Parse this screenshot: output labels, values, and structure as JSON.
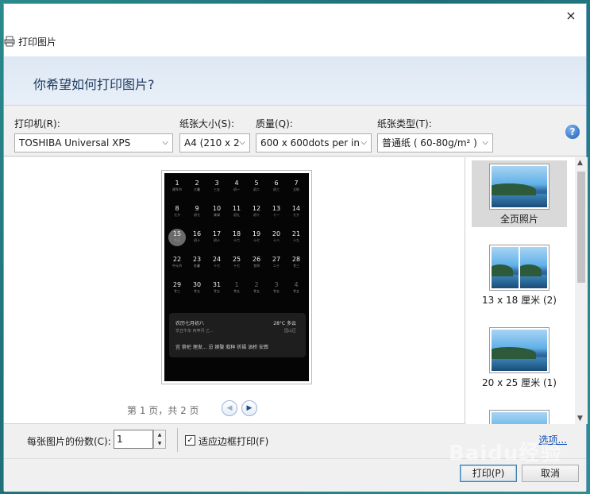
{
  "window": {
    "title": "打印图片",
    "close_glyph": "×"
  },
  "banner": {
    "heading": "你希望如何打印图片?"
  },
  "controls": {
    "printer": {
      "label": "打印机(R):",
      "value": "TOSHIBA Universal XPS"
    },
    "paper_size": {
      "label": "纸张大小(S):",
      "value": "A4 (210 x 2"
    },
    "quality": {
      "label": "质量(Q):",
      "value": "600 x 600dots per in"
    },
    "paper_type": {
      "label": "纸张类型(T):",
      "value": "普通纸 ( 60-80g/m² )"
    },
    "dropdown_glyph": "⌵",
    "help_glyph": "?"
  },
  "preview": {
    "calendar_rows": [
      [
        {
          "n": "1",
          "s": "建军节"
        },
        {
          "n": "2",
          "s": "大暑"
        },
        {
          "n": "3",
          "s": "三五"
        },
        {
          "n": "4",
          "s": "初一"
        },
        {
          "n": "5",
          "s": "初二"
        },
        {
          "n": "6",
          "s": "初三"
        },
        {
          "n": "7",
          "s": "立秋"
        }
      ],
      [
        {
          "n": "8",
          "s": "七夕"
        },
        {
          "n": "9",
          "s": "初七"
        },
        {
          "n": "10",
          "s": "乘绿"
        },
        {
          "n": "11",
          "s": "初九"
        },
        {
          "n": "12",
          "s": "初十"
        },
        {
          "n": "13",
          "s": "十一"
        },
        {
          "n": "14",
          "s": "七夕"
        }
      ],
      [
        {
          "n": "15",
          "s": "今天"
        },
        {
          "n": "16",
          "s": "初十"
        },
        {
          "n": "17",
          "s": "初十"
        },
        {
          "n": "18",
          "s": "十六"
        },
        {
          "n": "19",
          "s": "十七"
        },
        {
          "n": "20",
          "s": "十八"
        },
        {
          "n": "21",
          "s": "十九"
        }
      ],
      [
        {
          "n": "22",
          "s": "中元节"
        },
        {
          "n": "23",
          "s": "处暑"
        },
        {
          "n": "24",
          "s": "十七"
        },
        {
          "n": "25",
          "s": "十七"
        },
        {
          "n": "26",
          "s": "廿四"
        },
        {
          "n": "27",
          "s": "二十"
        },
        {
          "n": "28",
          "s": "廿三"
        }
      ],
      [
        {
          "n": "29",
          "s": "廿三"
        },
        {
          "n": "30",
          "s": "廿五"
        },
        {
          "n": "31",
          "s": "廿五"
        },
        {
          "n": "1",
          "s": "廿五",
          "dim": true
        },
        {
          "n": "2",
          "s": "廿五",
          "dim": true
        },
        {
          "n": "3",
          "s": "廿五",
          "dim": true
        },
        {
          "n": "4",
          "s": "廿五",
          "dim": true
        }
      ]
    ],
    "card": {
      "lunar": "农历七月初八",
      "ganzhi": "辛丑牛年 丙申月 乙...",
      "weather": "28°C 多云",
      "district": "国山区",
      "dos_donts": "宜 祭祀 理发...   忌 嫁娶 栽种 祈福 油桥 安葬"
    },
    "pager_text": "第 1 页，共 2 页",
    "prev_glyph": "◀",
    "next_glyph": "▶"
  },
  "layouts": [
    {
      "label": "全页照片",
      "selected": true
    },
    {
      "label": "13 x 18 厘米 (2)",
      "selected": false
    },
    {
      "label": "20 x 25 厘米 (1)",
      "selected": false
    },
    {
      "label": "",
      "selected": false
    }
  ],
  "scrollbar": {
    "up_glyph": "▲",
    "down_glyph": "▼"
  },
  "footer": {
    "copies_label": "每张图片的份数(C):",
    "copies_value": "1",
    "spin_up": "▲",
    "spin_down": "▼",
    "fit_checked": true,
    "check_glyph": "✓",
    "fit_label": "适应边框打印(F)",
    "options_link": "选项...",
    "print_button": "打印(P)",
    "cancel_button": "取消"
  },
  "watermark": "Baidu经验"
}
